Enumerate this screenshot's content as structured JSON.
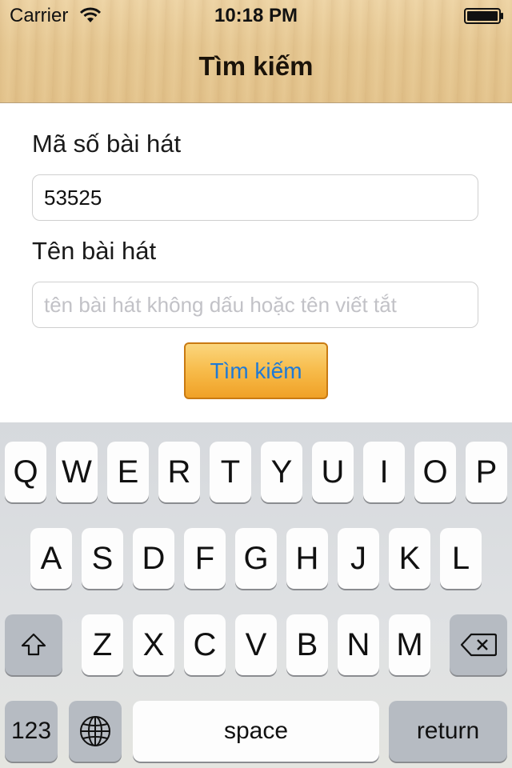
{
  "status_bar": {
    "carrier": "Carrier",
    "time": "10:18 PM"
  },
  "nav": {
    "title": "Tìm kiếm"
  },
  "form": {
    "code_label": "Mã số bài hát",
    "code_value": "53525",
    "name_label": "Tên bài hát",
    "name_placeholder": "tên bài hát không dấu hoặc tên viết tắt",
    "search_button": "Tìm kiếm"
  },
  "colors": {
    "button_text": "#1f7ad6",
    "button_border": "#c97a12"
  },
  "keyboard": {
    "row1": [
      "Q",
      "W",
      "E",
      "R",
      "T",
      "Y",
      "U",
      "I",
      "O",
      "P"
    ],
    "row2": [
      "A",
      "S",
      "D",
      "F",
      "G",
      "H",
      "J",
      "K",
      "L"
    ],
    "row3": [
      "Z",
      "X",
      "C",
      "V",
      "B",
      "N",
      "M"
    ],
    "numbers_key": "123",
    "space_key": "space",
    "return_key": "return",
    "shift_icon": "shift-icon",
    "globe_icon": "globe-icon",
    "backspace_icon": "backspace-icon"
  }
}
